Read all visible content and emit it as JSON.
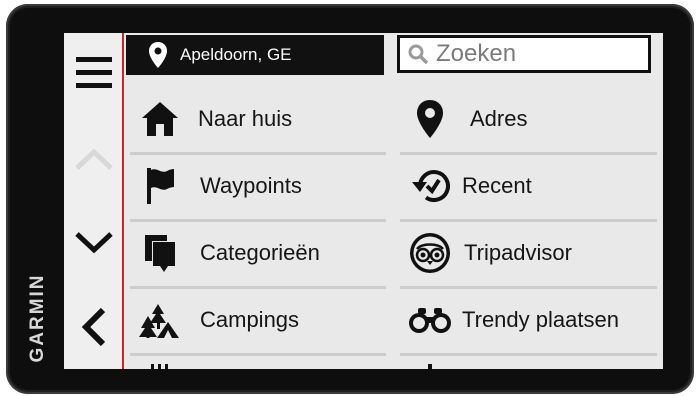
{
  "brand": "GARMIN",
  "location": {
    "label": "Apeldoorn, GE"
  },
  "search": {
    "placeholder": "Zoeken"
  },
  "side_menu": {
    "menu_icon": "hamburger-menu-icon",
    "scroll_up_icon": "chevron-up-icon",
    "scroll_down_icon": "chevron-down-icon",
    "back_icon": "back-arrow-icon"
  },
  "tiles": [
    {
      "label": "Naar huis",
      "icon": "home-icon"
    },
    {
      "label": "Adres",
      "icon": "map-pin-icon"
    },
    {
      "label": "Waypoints",
      "icon": "flag-icon"
    },
    {
      "label": "Recent",
      "icon": "history-icon"
    },
    {
      "label": "Categorieën",
      "icon": "categories-icon"
    },
    {
      "label": "Tripadvisor",
      "icon": "tripadvisor-icon"
    },
    {
      "label": "Campings",
      "icon": "camping-icon"
    },
    {
      "label": "Trendy plaatsen",
      "icon": "binoculars-icon"
    }
  ],
  "colors": {
    "accent_red": "#c9242a",
    "screen_bg": "#e9e9e9",
    "bar_black": "#111111"
  }
}
